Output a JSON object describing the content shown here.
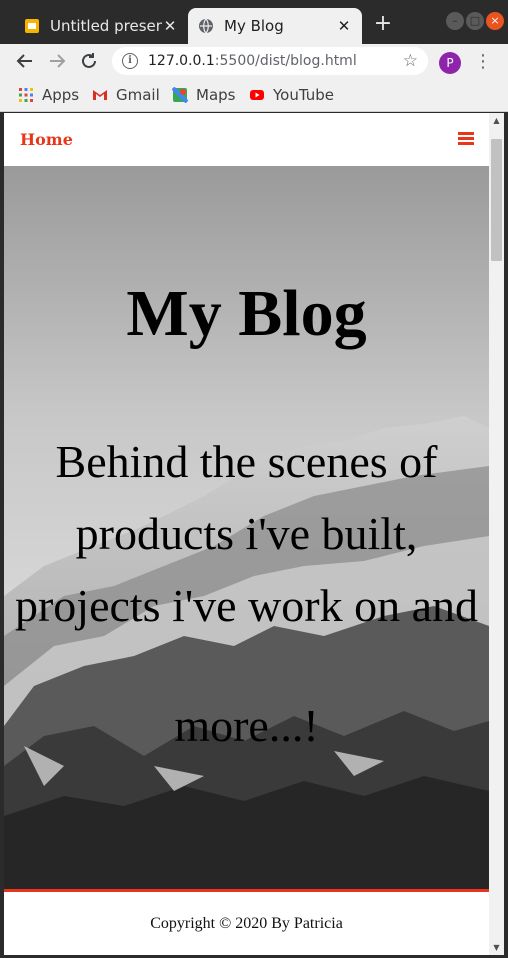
{
  "browser": {
    "tabs": [
      {
        "title": "Untitled presentation",
        "favicon": "slides-icon",
        "close": "✕"
      },
      {
        "title": "My Blog",
        "favicon": "globe-icon",
        "close": "✕"
      }
    ],
    "new_tab": "+",
    "url_host": "127.0.0.1",
    "url_path": ":5500/dist/blog.html",
    "profile_initial": "P",
    "bookmarks": [
      {
        "label": "Apps",
        "icon": "apps-grid-icon"
      },
      {
        "label": "Gmail",
        "icon": "gmail-icon"
      },
      {
        "label": "Maps",
        "icon": "maps-icon"
      },
      {
        "label": "YouTube",
        "icon": "youtube-icon"
      }
    ],
    "colors": {
      "accent": "#e8361b",
      "tab_active": "#f0f0f0",
      "chrome_dark": "#2b2b2b"
    }
  },
  "page": {
    "nav": {
      "home_label": "Home",
      "menu_icon": "hamburger-menu-icon"
    },
    "hero": {
      "title": "My Blog",
      "subtitle_line1": "Behind the scenes of",
      "subtitle_line2": "products i've built,",
      "subtitle_line3": "projects i've work on and",
      "subtitle_line4": "more...!"
    },
    "footer": {
      "copyright": "Copyright © 2020 By Patricia"
    }
  }
}
